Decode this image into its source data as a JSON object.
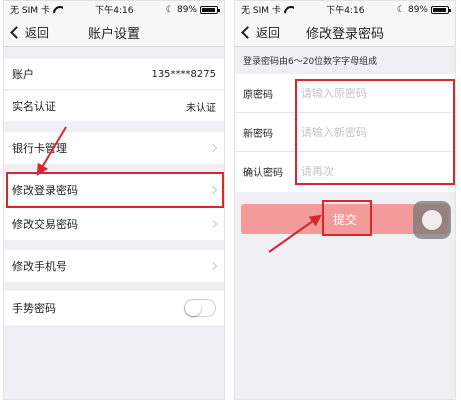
{
  "status_bar": {
    "carrier": "无 SIM 卡",
    "time": "下午4:16",
    "battery": "89%"
  },
  "left": {
    "nav": {
      "back_label": "返回",
      "title": "账户设置"
    },
    "rows": {
      "account": {
        "label": "账户",
        "value": "135****8275"
      },
      "verify": {
        "label": "实名认证",
        "value": "未认证"
      },
      "bank": {
        "label": "银行卡管理"
      },
      "login_pwd": {
        "label": "修改登录密码"
      },
      "trade_pwd": {
        "label": "修改交易密码"
      },
      "phone": {
        "label": "修改手机号"
      },
      "gesture": {
        "label": "手势密码"
      }
    }
  },
  "right": {
    "nav": {
      "back_label": "返回",
      "title": "修改登录密码"
    },
    "hint": "登录密码由6～20位数字字母组成",
    "fields": {
      "old": {
        "label": "原密码",
        "placeholder": "请输入原密码"
      },
      "new": {
        "label": "新密码",
        "placeholder": "请输入新密码"
      },
      "confirm": {
        "label": "确认密码",
        "placeholder": "请再次"
      }
    },
    "submit_label": "提交"
  },
  "colors": {
    "highlight_red": "#d7282f",
    "submit_bg": "#f39a9a",
    "page_bg": "#efeff4"
  },
  "icons": [
    "wifi-icon",
    "moon-icon",
    "battery-icon",
    "back-chevron-icon",
    "chevron-right-icon",
    "toggle-switch",
    "assistive-touch-icon",
    "arrow-annotation-icon"
  ]
}
